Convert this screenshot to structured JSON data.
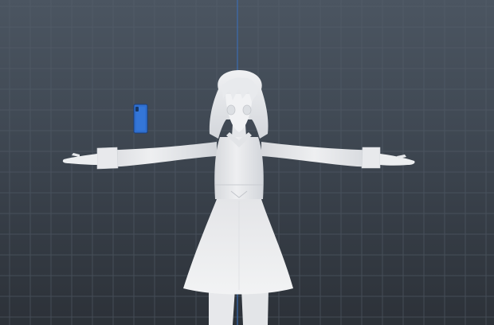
{
  "viewport": {
    "background_top": "#4b5561",
    "background_bottom": "#2c3138",
    "grid_color": "#56606c",
    "axis_color": "#3a6fb8"
  },
  "character": {
    "pose": "T-pose",
    "material_color": "#e9eaec",
    "shade_color": "#c9ccd1"
  },
  "prop": {
    "icon": "smartphone-icon",
    "color": "#2f6fd0",
    "edge_color": "#1b3f7a"
  }
}
